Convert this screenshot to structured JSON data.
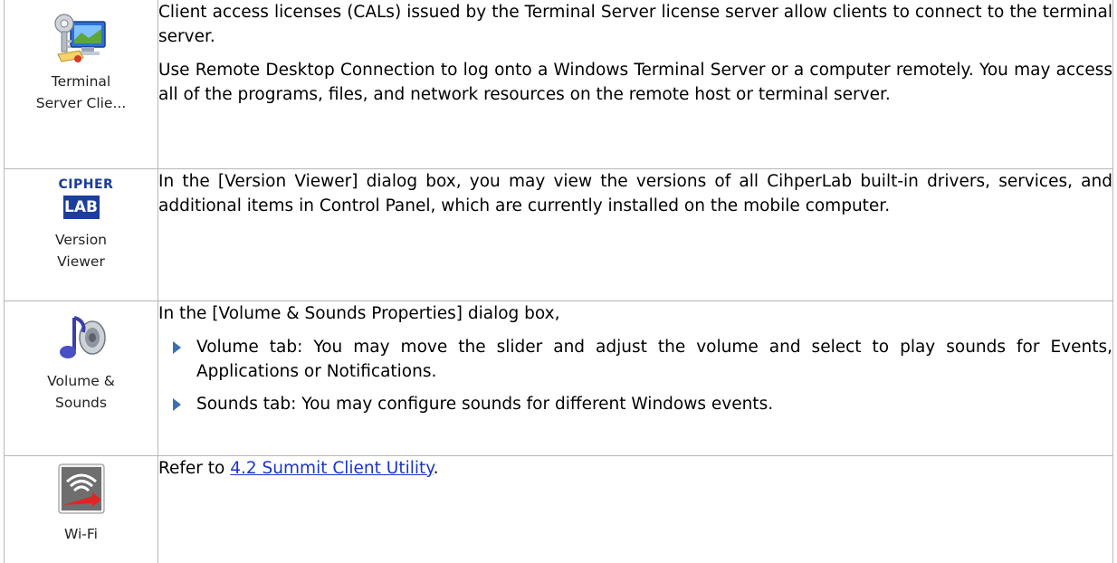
{
  "rows": [
    {
      "icon": "terminal-server-client-icon",
      "label_line1": "Terminal",
      "label_line2": "Server Clie...",
      "paragraphs": [
        "Client access licenses (CALs) issued by the Terminal Server license server allow clients to connect to the terminal server.",
        "Use Remote Desktop Connection to log onto a Windows Terminal Server or a computer remotely. You may access all of the programs, files, and network resources on the remote host or terminal server."
      ]
    },
    {
      "icon": "cipherlab-logo-icon",
      "logo_top": "CIPHER",
      "logo_bottom": "LAB",
      "label_line1": "Version",
      "label_line2": "Viewer",
      "paragraphs": [
        "In the [Version Viewer] dialog box, you may view the versions of all CihperLab built-in drivers, services, and additional items in Control Panel, which are currently installed on the mobile computer."
      ]
    },
    {
      "icon": "volume-sounds-icon",
      "label_line1": "Volume &",
      "label_line2": "Sounds",
      "intro": "In the [Volume & Sounds Properties] dialog box,",
      "bullets": [
        "Volume tab: You may move the slider and adjust the volume and select to play sounds for Events, Applications or Notifications.",
        "Sounds tab: You may configure sounds for different Windows events."
      ]
    },
    {
      "icon": "wifi-icon",
      "label_line1": "Wi-Fi",
      "text_before": "Refer to ",
      "link_text": "4.2 Summit Client Utility",
      "text_after": "."
    }
  ],
  "colors": {
    "border": "#b7b7b7",
    "link": "#1a35c8",
    "bullet": "#3a6fb0"
  }
}
